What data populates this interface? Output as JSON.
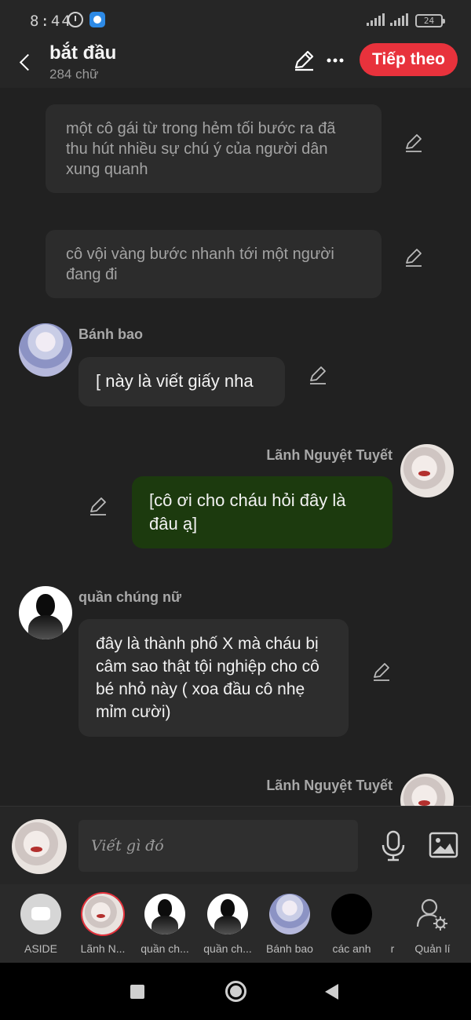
{
  "status": {
    "time": "8:44",
    "battery": "24"
  },
  "header": {
    "title": "bắt đầu",
    "subtitle": "284 chữ",
    "next_label": "Tiếp theo"
  },
  "chat": {
    "narration": [
      "một cô gái từ trong hẻm tối bước ra đã thu hút nhiều sự chú ý của người dân xung quanh",
      "cô vội vàng bước nhanh tới một người đang đi"
    ],
    "messages": [
      {
        "sender": "Bánh bao",
        "side": "left",
        "text": "[ này là viết giấy nha"
      },
      {
        "sender": "Lãnh Nguyệt Tuyết",
        "side": "right",
        "text": "[cô ơi cho cháu hỏi đây là đâu ạ]"
      },
      {
        "sender": "quần chúng nữ",
        "side": "left",
        "text": "đây là thành phố X mà cháu bị câm sao thật tội nghiệp cho cô bé nhỏ này ( xoa đầu cô nhẹ mỉm cười)"
      },
      {
        "sender": "Lãnh Nguyệt Tuyết",
        "side": "right",
        "text": ""
      }
    ]
  },
  "input": {
    "placeholder": "Viết gì đó"
  },
  "characters": [
    {
      "label": "ASIDE",
      "icon": "chat-bubble-icon"
    },
    {
      "label": "Lãnh N...",
      "icon": "anime-girl-red-eyes",
      "selected": true
    },
    {
      "label": "quần ch...",
      "icon": "silhouette-female"
    },
    {
      "label": "quần ch...",
      "icon": "silhouette-male"
    },
    {
      "label": "Bánh bao",
      "icon": "anime-girl-blue-hair"
    },
    {
      "label": "các anh",
      "icon": "black-circle"
    },
    {
      "label": "r",
      "icon": ""
    },
    {
      "label": "Quản lí",
      "icon": "user-gear-icon"
    }
  ],
  "colors": {
    "accent": "#e8323c",
    "right_bubble": "#1c3a0e",
    "background": "#212121"
  }
}
